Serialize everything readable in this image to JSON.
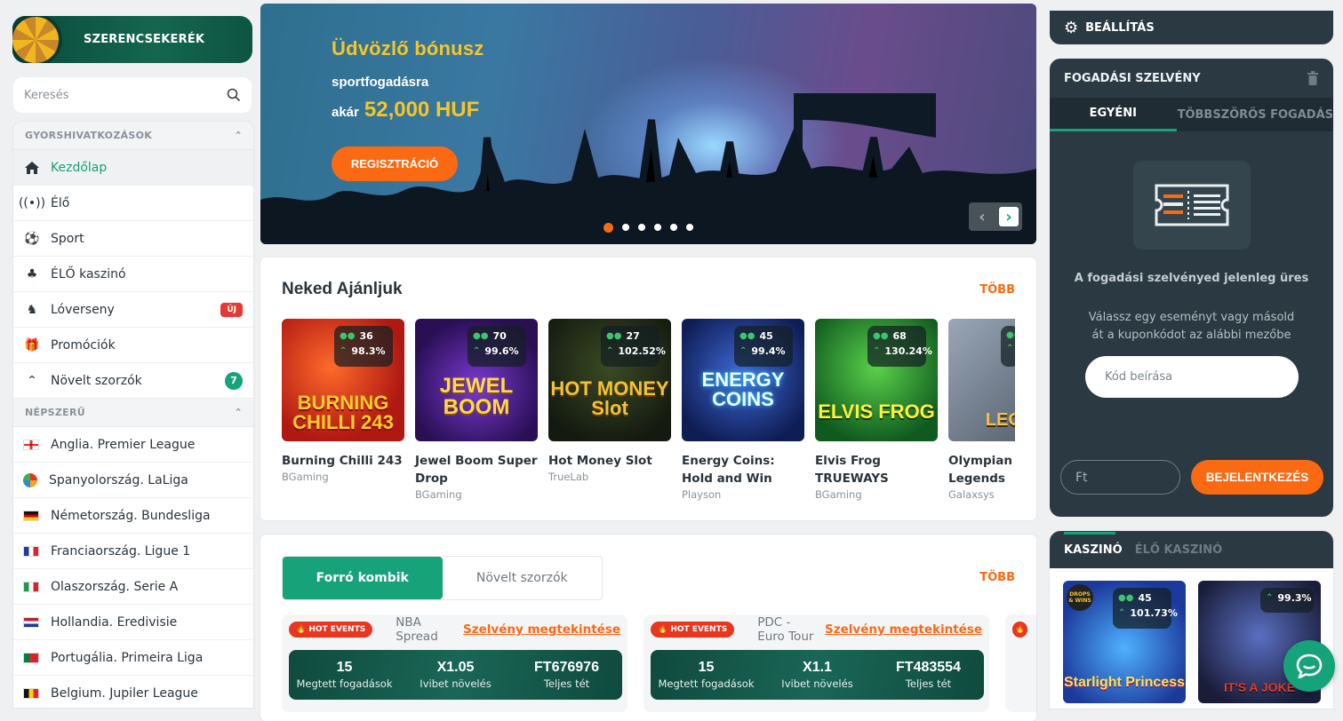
{
  "sidebar": {
    "wheel_title": "SZERENCSEKERÉK",
    "search_placeholder": "Keresés",
    "quick_section": "GYORSHIVATKOZÁSOK",
    "quick_links": [
      {
        "label": "Kezdőlap",
        "icon": "home-icon"
      },
      {
        "label": "Élő",
        "icon": "live-broadcast-icon"
      },
      {
        "label": "Sport",
        "icon": "soccer-ball-icon"
      },
      {
        "label": "ÉLŐ kaszinó",
        "icon": "live-casino-icon"
      },
      {
        "label": "Lóverseny",
        "icon": "horse-icon",
        "badge": "ÚJ"
      },
      {
        "label": "Promóciók",
        "icon": "gift-icon"
      },
      {
        "label": "Növelt szorzók",
        "icon": "boosted-odds-icon",
        "count": "7"
      }
    ],
    "popular_section": "NÉPSZERŰ",
    "leagues": [
      {
        "label": "Anglia. Premier League",
        "flag": "england"
      },
      {
        "label": "Spanyolország. LaLiga",
        "flag": "laliga"
      },
      {
        "label": "Németország. Bundesliga",
        "flag": "germany"
      },
      {
        "label": "Franciaország. Ligue 1",
        "flag": "france"
      },
      {
        "label": "Olaszország. Serie A",
        "flag": "italy"
      },
      {
        "label": "Hollandia. Eredivisie",
        "flag": "netherlands"
      },
      {
        "label": "Portugália. Primeira Liga",
        "flag": "portugal"
      },
      {
        "label": "Belgium. Jupiler League",
        "flag": "belgium"
      }
    ]
  },
  "hero": {
    "title": "Üdvözlő bónusz",
    "line2": "sportfogadásra",
    "line3_prefix": "akár",
    "amount": "52,000 HUF",
    "cta": "REGISZTRÁCIÓ",
    "slides": 6,
    "active_slide": 1
  },
  "recommended": {
    "title": "Neked Ajánljuk",
    "more": "TÖBB",
    "games": [
      {
        "name": "Burning Chilli 243",
        "provider": "BGaming",
        "players": "36",
        "rtp": "98.3%",
        "art": "BURNING CHILLI 243",
        "bg": "#c7201c"
      },
      {
        "name": "Jewel Boom Super Drop",
        "provider": "BGaming",
        "players": "70",
        "rtp": "99.6%",
        "art": "JEWEL BOOM",
        "bg": "#3d1a74"
      },
      {
        "name": "Hot Money Slot",
        "provider": "TrueLab",
        "players": "27",
        "rtp": "102.52%",
        "art": "HOT MONEY Slot",
        "bg": "#1f2a18"
      },
      {
        "name": "Energy Coins: Hold and Win",
        "provider": "Playson",
        "players": "45",
        "rtp": "99.4%",
        "art": "ENERGY COINS",
        "bg": "#1a2a6e"
      },
      {
        "name": "Elvis Frog TRUEWAYS",
        "provider": "BGaming",
        "players": "68",
        "rtp": "130.24%",
        "art": "ELVIS FROG",
        "bg": "#1f7a2c"
      },
      {
        "name": "Olympian Legends",
        "provider": "Galaxsys",
        "players": "",
        "rtp": "",
        "art": "LEGE",
        "bg": "#6d7a88"
      }
    ]
  },
  "combos": {
    "tab_active": "Forró kombik",
    "tab_inactive": "Növelt szorzók",
    "more": "TÖBB",
    "hot_label": "HOT EVENTS",
    "view_label": "Szelvény megtekintése",
    "items": [
      {
        "event": "NBA Spread",
        "bets": "15",
        "bets_label": "Megtett fogadások",
        "boost": "X1.05",
        "boost_label": "Ivibet növelés",
        "total": "FT676976",
        "total_label": "Teljes tét"
      },
      {
        "event": "PDC - Euro Tour",
        "bets": "15",
        "bets_label": "Megtett fogadások",
        "boost": "X1.1",
        "boost_label": "Ivibet növelés",
        "total": "FT483554",
        "total_label": "Teljes tét"
      }
    ]
  },
  "right": {
    "settings": "BEÁLLÍTÁS",
    "slip_title": "FOGADÁSI SZELVÉNY",
    "tab_single": "EGYÉNI",
    "tab_multi": "TÖBBSZÖRÖS FOGADÁS",
    "empty_title": "A fogadási szelvényed jelenleg üres",
    "empty_desc": "Válassz egy eseményt vagy másold át a kuponkódot az alábbi mezőbe",
    "code_placeholder": "Kód beírása",
    "amount_placeholder": "Ft",
    "login": "BEJELENTKEZÉS",
    "casino_tab": "KASZINÓ",
    "live_casino_tab": "ÉLŐ KASZINÓ",
    "casino_tiles": [
      {
        "players": "45",
        "rtp": "101.73%",
        "art": "Starlight Princess",
        "badge": "DROPS & WINS"
      },
      {
        "players": "",
        "rtp": "99.3%",
        "art": "IT'S A JOKE"
      }
    ]
  },
  "colors": {
    "accent": "#17a37a",
    "cta": "#fb6a12",
    "dark": "#2b3a42"
  }
}
